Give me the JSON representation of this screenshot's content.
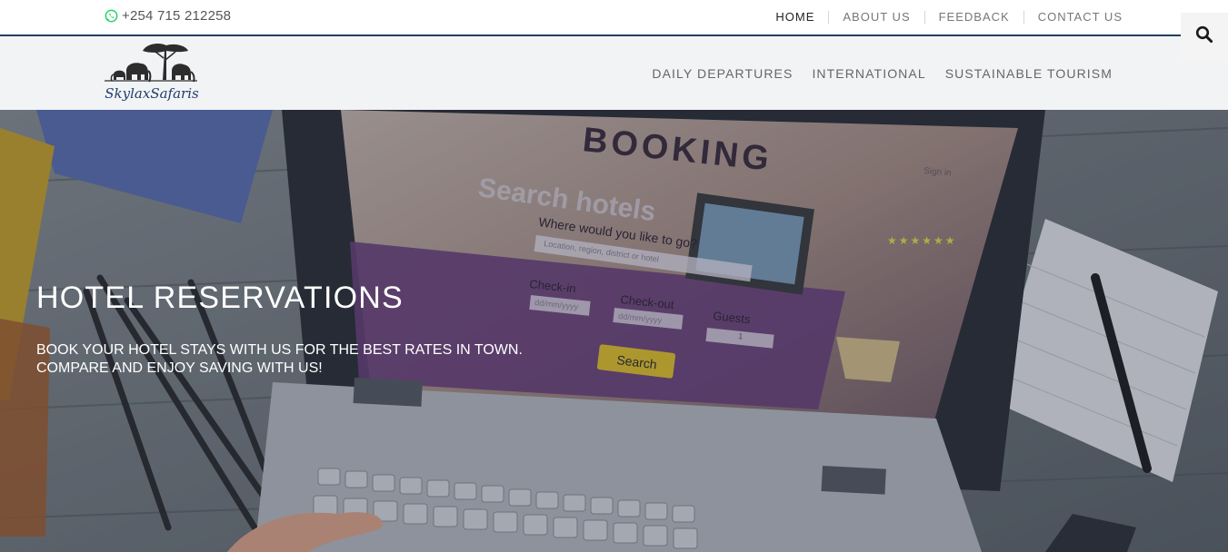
{
  "topbar": {
    "phone": "+254 715 212258",
    "phone_icon": "whatsapp-icon",
    "nav": [
      "HOME",
      "ABOUT US",
      "FEEDBACK",
      "CONTACT US"
    ],
    "search_icon": "search-icon"
  },
  "header": {
    "logo_text": "SkylaxSafaris",
    "nav": [
      "DAILY DEPARTURES",
      "INTERNATIONAL",
      "SUSTAINABLE TOURISM"
    ]
  },
  "hero": {
    "title": "HOTEL RESERVATIONS",
    "subtitle_line1": "BOOK YOUR HOTEL STAYS WITH US FOR THE BEST RATES IN TOWN.",
    "subtitle_line2": "COMPARE AND ENJOY SAVING WITH US!",
    "image": {
      "screen_heading": "BOOKING",
      "screen_search_title": "Search hotels",
      "screen_question": "Where would you like to go?",
      "screen_location_placeholder": "Location, region, district or hotel",
      "screen_sign_in": "Sign in",
      "screen_checkin": "Check-in",
      "screen_checkout": "Check-out",
      "screen_guests": "Guests",
      "screen_date_placeholder": "dd/mm/yyyy",
      "screen_guests_value": "1",
      "screen_button": "Search"
    }
  },
  "colors": {
    "topbar_border": "#1f3f5e",
    "header_bg": "#f2f3f5",
    "whatsapp_green": "#25d366",
    "logo_blue": "#1f3f6b"
  }
}
